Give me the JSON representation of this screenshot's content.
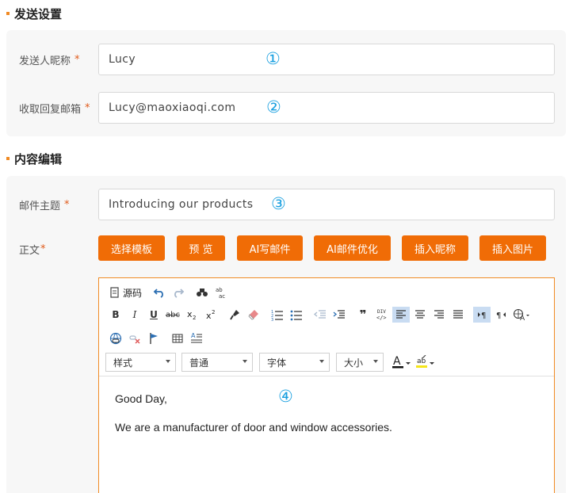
{
  "send_settings": {
    "title": "发送设置",
    "sender_name_label": "发送人昵称",
    "sender_name_value": "Lucy",
    "reply_email_label": "收取回复邮箱",
    "reply_email_value": "Lucy@maoxiaoqi.com",
    "required_mark": "*"
  },
  "content_edit": {
    "title": "内容编辑",
    "subject_label": "邮件主题",
    "subject_value": "Introducing our products",
    "body_label": "正文",
    "required_mark": "*"
  },
  "buttons": {
    "select_template": "选择模板",
    "preview": "预 览",
    "ai_write": "AI写邮件",
    "ai_optimize": "AI邮件优化",
    "insert_nickname": "插入昵称",
    "insert_image": "插入图片"
  },
  "toolbar": {
    "source_label": "源码",
    "style_select": "样式",
    "format_select": "普通",
    "font_select": "字体",
    "size_select": "大小"
  },
  "editor_content": {
    "line1": "Good Day,",
    "line2": "We are a manufacturer of door and window accessories."
  },
  "markers": {
    "m1": "①",
    "m2": "②",
    "m3": "③",
    "m4": "④"
  },
  "colors": {
    "accent": "#f06c06",
    "marker": "#1aa0e0",
    "panel_bg": "#f7f7f7"
  }
}
